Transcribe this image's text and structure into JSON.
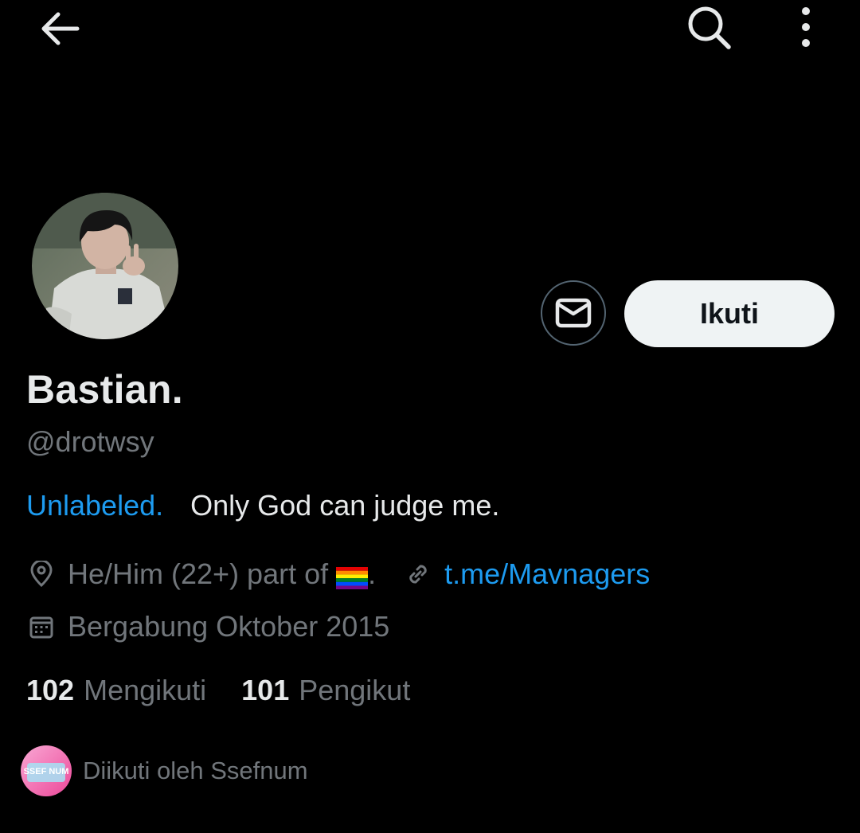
{
  "profile": {
    "display_name": "Bastian.",
    "handle": "@drotwsy",
    "bio_link": "Unlabeled.",
    "bio_text": "Only God can judge me.",
    "location_text": "He/Him (22+) part of",
    "location_suffix": ".",
    "location_flag": "rainbow-flag-icon",
    "website": "t.me/Mavnagers",
    "joined": "Bergabung Oktober 2015"
  },
  "counts": {
    "following_count": "102",
    "following_label": "Mengikuti",
    "followers_count": "101",
    "followers_label": "Pengikut"
  },
  "followed_by": {
    "text": "Diikuti oleh Ssefnum",
    "avatar_text": "SSEF NUM"
  },
  "actions": {
    "follow_label": "Ikuti"
  },
  "icons": {
    "back": "arrow-left-icon",
    "search": "search-icon",
    "more": "more-vertical-icon",
    "message": "envelope-icon",
    "location": "location-pin-icon",
    "link": "link-icon",
    "calendar": "calendar-icon"
  },
  "colors": {
    "background": "#000000",
    "text_primary": "#e7e9ea",
    "text_secondary": "#71767b",
    "link": "#1d9bf0",
    "follow_button_bg": "#eff3f4"
  }
}
